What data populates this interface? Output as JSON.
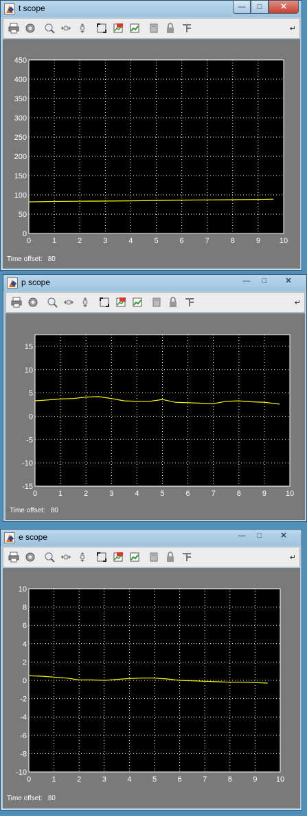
{
  "windows": [
    {
      "id": "t",
      "title": "t scope",
      "time_offset_label": "Time offset:",
      "time_offset_value": "80",
      "chart_data": {
        "type": "line",
        "x_ticks": [
          0,
          1,
          2,
          3,
          4,
          5,
          6,
          7,
          8,
          9,
          10
        ],
        "y_ticks": [
          0,
          50,
          100,
          150,
          200,
          250,
          300,
          350,
          400,
          450
        ],
        "xlim": [
          0,
          10
        ],
        "ylim": [
          0,
          450
        ],
        "grid": true,
        "line_color": "#ffff00",
        "series": [
          {
            "x": [
              0,
              1,
              2,
              3,
              4,
              5,
              6,
              7,
              8,
              9,
              9.6
            ],
            "y": [
              82,
              83,
              83.5,
              84,
              84.5,
              85.5,
              86.5,
              87,
              87.5,
              88,
              89
            ]
          }
        ]
      }
    },
    {
      "id": "p",
      "title": "p scope",
      "time_offset_label": "Time offset:",
      "time_offset_value": "80",
      "chart_data": {
        "type": "line",
        "x_ticks": [
          0,
          1,
          2,
          3,
          4,
          5,
          6,
          7,
          8,
          9,
          10
        ],
        "y_ticks": [
          -15,
          -10,
          -5,
          0,
          5,
          10,
          15
        ],
        "xlim": [
          0,
          10
        ],
        "ylim": [
          -15,
          17.5
        ],
        "grid": true,
        "line_color": "#ffff00",
        "series": [
          {
            "x": [
              0,
              0.5,
              1,
              1.5,
              2,
              2.5,
              3,
              3.5,
              4,
              4.5,
              5,
              5.5,
              6,
              6.5,
              7,
              7.5,
              8,
              8.5,
              9,
              9.6
            ],
            "y": [
              3.3,
              3.5,
              3.7,
              3.8,
              4.1,
              4.2,
              3.8,
              3.3,
              3.2,
              3.2,
              3.6,
              3.0,
              2.9,
              2.8,
              2.7,
              3.2,
              3.3,
              3.1,
              3.0,
              2.6
            ]
          }
        ]
      }
    },
    {
      "id": "e",
      "title": "e scope",
      "time_offset_label": "Time offset:",
      "time_offset_value": "80",
      "chart_data": {
        "type": "line",
        "x_ticks": [
          0,
          1,
          2,
          3,
          4,
          5,
          6,
          7,
          8,
          9,
          10
        ],
        "y_ticks": [
          -10,
          -8,
          -6,
          -4,
          -2,
          0,
          2,
          4,
          6,
          8,
          10
        ],
        "xlim": [
          0,
          10
        ],
        "ylim": [
          -10,
          10
        ],
        "grid": true,
        "line_color": "#ffff00",
        "series": [
          {
            "x": [
              0,
              0.5,
              1,
              1.5,
              2,
              2.5,
              3,
              3.5,
              4,
              4.5,
              5,
              5.5,
              6,
              6.5,
              7,
              7.5,
              8,
              8.5,
              9,
              9.5
            ],
            "y": [
              0.5,
              0.45,
              0.35,
              0.25,
              0.05,
              0.05,
              0.0,
              0.1,
              0.2,
              0.25,
              0.25,
              0.15,
              0.0,
              -0.05,
              -0.1,
              -0.15,
              -0.2,
              -0.2,
              -0.25,
              -0.3
            ]
          }
        ]
      }
    }
  ]
}
